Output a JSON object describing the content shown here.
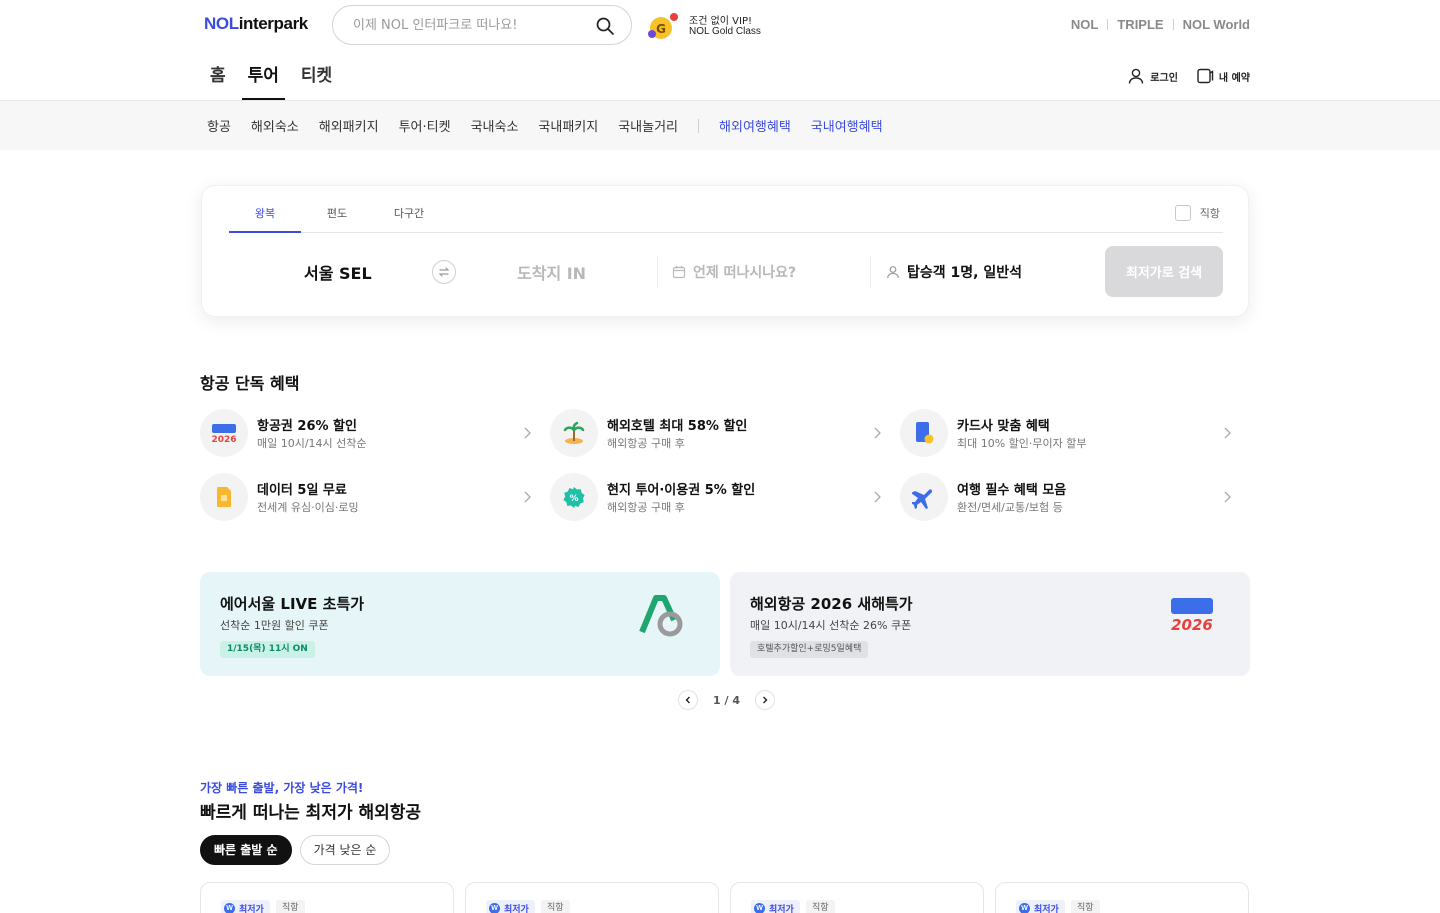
{
  "header": {
    "logo_nol": "NOL",
    "logo_interpark": "interpark",
    "search_placeholder": "이제 NOL 인터파크로 떠나요!",
    "vip_line1": "조건 없이 VIP!",
    "vip_line2": "NOL Gold Class",
    "brands": [
      "NOL",
      "TRIPLE",
      "NOL World"
    ],
    "tabs": [
      "홈",
      "투어",
      "티켓"
    ],
    "login": "로그인",
    "my_booking": "내 예약"
  },
  "subnav": {
    "items": [
      "항공",
      "해외숙소",
      "해외패키지",
      "투어·티켓",
      "국내숙소",
      "국내패키지",
      "국내놀거리"
    ],
    "highlight_items": [
      "해외여행혜택",
      "국내여행혜택"
    ]
  },
  "flight_search": {
    "tabs": [
      "왕복",
      "편도",
      "다구간"
    ],
    "direct_label": "직항",
    "from": "서울 SEL",
    "to": "도착지 IN",
    "date_placeholder": "언제 떠나시나요?",
    "passengers": "탑승객 1명, 일반석",
    "search_button": "최저가로 검색"
  },
  "benefits": {
    "title": "항공 단독 혜택",
    "items": [
      {
        "title": "항공권 26% 할인",
        "sub": "매일 10시/14시 선착순",
        "icon": "newyear-2026-icon"
      },
      {
        "title": "해외호텔 최대 58% 할인",
        "sub": "해외항공 구매 후",
        "icon": "island-icon"
      },
      {
        "title": "카드사 맞춤 혜택",
        "sub": "최대 10% 할인·무이자 할부",
        "icon": "card-icon"
      },
      {
        "title": "데이터 5일 무료",
        "sub": "전세계 유심·이심·로밍",
        "icon": "sim-card-icon"
      },
      {
        "title": "현지 투어·이용권 5% 할인",
        "sub": "해외항공 구매 후",
        "icon": "discount-badge-icon"
      },
      {
        "title": "여행 필수 혜택 모음",
        "sub": "환전/면세/교통/보험 등",
        "icon": "plane-icon"
      }
    ]
  },
  "promos": [
    {
      "title": "에어서울 LIVE 초특가",
      "sub": "선착순 1만원 할인 쿠폰",
      "badge": "1/15(목) 11시 ON",
      "icon": "airseoul-logo-icon"
    },
    {
      "title": "해외항공 2026 새해특가",
      "sub": "매일 10시/14시 선착순 26% 쿠폰",
      "badge": "호텔추가할인+로밍5일혜택",
      "icon": "newyear-2026-icon"
    }
  ],
  "pager": {
    "current": "1",
    "total": "4",
    "text": "1 / 4"
  },
  "cheapest": {
    "kicker": "가장 빠른 출발, 가장 낮은 가격!",
    "title": "빠르게 떠나는 최저가 해외항공",
    "chips": [
      "빠른 출발 순",
      "가격 낮은 순"
    ],
    "card_tag1": "최저가",
    "card_tag2": "직항",
    "card_tag_logo": "W"
  },
  "colors": {
    "accent": "#3b4be0",
    "promo1_bg": "#e6f6f8",
    "promo2_bg": "#f1f2f5",
    "badge1_bg": "#c9f1e6",
    "badge1_fg": "#0c8a6c"
  }
}
